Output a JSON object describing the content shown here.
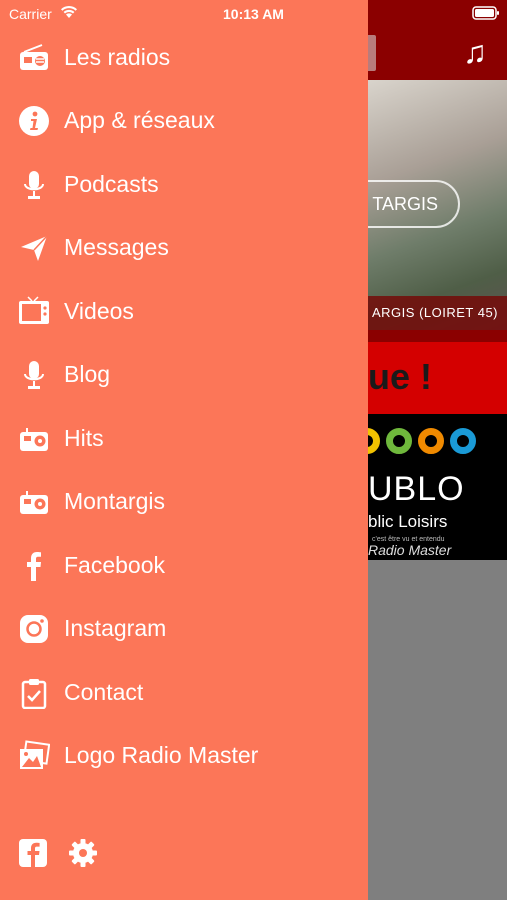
{
  "status_bar": {
    "carrier": "Carrier",
    "time": "10:13 AM"
  },
  "menu": {
    "items": [
      {
        "label": "Les radios",
        "icon": "radio-icon"
      },
      {
        "label": "App & réseaux",
        "icon": "info-icon"
      },
      {
        "label": "Podcasts",
        "icon": "microphone-icon"
      },
      {
        "label": "Messages",
        "icon": "paper-plane-icon"
      },
      {
        "label": "Videos",
        "icon": "tv-icon"
      },
      {
        "label": "Blog",
        "icon": "microphone-icon"
      },
      {
        "label": "Hits",
        "icon": "radio-icon"
      },
      {
        "label": "Montargis",
        "icon": "radio-icon"
      },
      {
        "label": "Facebook",
        "icon": "facebook-icon"
      },
      {
        "label": "Instagram",
        "icon": "instagram-icon"
      },
      {
        "label": "Contact",
        "icon": "clipboard-icon"
      },
      {
        "label": "Logo Radio Master",
        "icon": "image-icon"
      }
    ]
  },
  "footer": {
    "facebook_icon": "facebook-square-icon",
    "settings_icon": "gear-icon"
  },
  "background_app": {
    "photo_button": "TARGIS",
    "photo_caption": "ARGIS (LOIRET 45)",
    "banner_text": "ue !",
    "logo_word": "UBLO",
    "logo_sub": "blic Loisirs",
    "logo_tiny": "c'est être vu et entendu",
    "logo_footer": "Radio Master"
  },
  "colors": {
    "drawer": "#fc7658",
    "header": "#8b0000",
    "banner": "#d40000",
    "overlay": "#808080"
  }
}
